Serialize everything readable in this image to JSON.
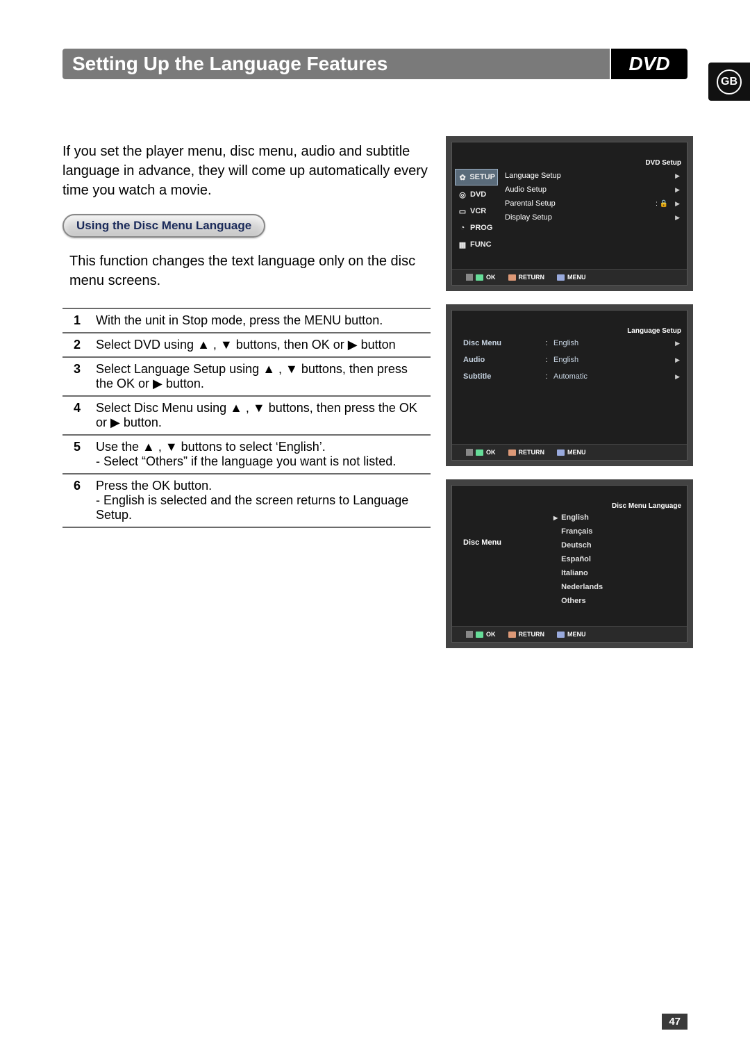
{
  "title": "Setting Up the Language Features",
  "title_badge": "DVD",
  "side_tab": "GB",
  "intro": "If you set the player menu, disc menu, audio and subtitle language in advance, they will come up automatically every time you watch a movie.",
  "section_pill": "Using the Disc Menu Language",
  "section_desc": "This function changes the text language only on the disc menu screens.",
  "steps": [
    {
      "n": "1",
      "text": "With the unit in Stop mode, press the MENU button."
    },
    {
      "n": "2",
      "text": "Select DVD using ▲ , ▼ buttons, then OK or ▶ button"
    },
    {
      "n": "3",
      "text": "Select Language Setup using ▲ , ▼ buttons, then press the OK or ▶ button."
    },
    {
      "n": "4",
      "text": "Select Disc Menu using ▲ , ▼ buttons, then press the OK or ▶ button."
    },
    {
      "n": "5",
      "text": "Use the ▲ , ▼ buttons to select ‘English’.\n- Select “Others” if the language you want is not listed."
    },
    {
      "n": "6",
      "text": "Press the OK button.\n- English is selected and the screen returns to Language Setup."
    }
  ],
  "osd1": {
    "header": "DVD Setup",
    "side": [
      "SETUP",
      "DVD",
      "VCR",
      "PROG",
      "FUNC"
    ],
    "side_selected": 0,
    "items": [
      "Language Setup",
      "Audio Setup",
      "Parental Setup",
      "Display Setup"
    ]
  },
  "osd2": {
    "header": "Language Setup",
    "rows": [
      {
        "label": "Disc Menu",
        "value": "English"
      },
      {
        "label": "Audio",
        "value": "English"
      },
      {
        "label": "Subtitle",
        "value": "Automatic"
      }
    ]
  },
  "osd3": {
    "header": "Disc Menu Language",
    "left_label": "Disc Menu",
    "selected": "English",
    "languages": [
      "English",
      "Français",
      "Deutsch",
      "Español",
      "Italiano",
      "Nederlands",
      "Others"
    ]
  },
  "footer": {
    "ok": "OK",
    "return": "RETURN",
    "menu": "MENU"
  },
  "page_number": "47"
}
